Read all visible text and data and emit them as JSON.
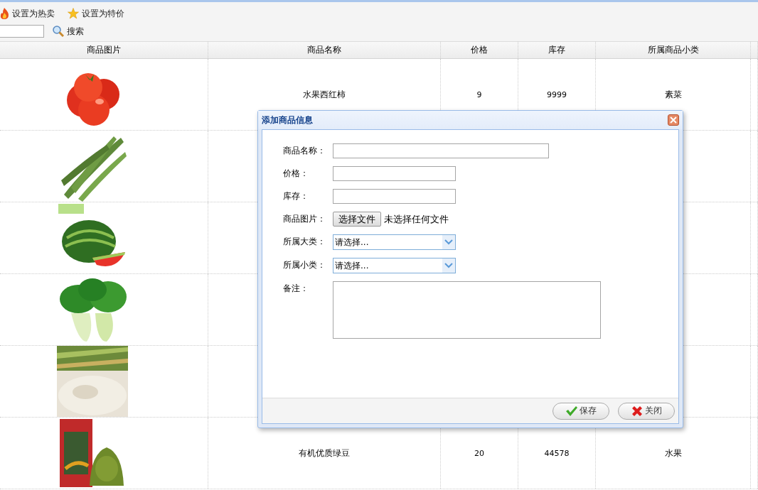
{
  "toolbar": {
    "actions": [
      {
        "label": "设置为热卖",
        "kind": "hot"
      },
      {
        "label": "设置为特价",
        "kind": "special"
      }
    ],
    "search_button": "搜索"
  },
  "table": {
    "columns": [
      "商品图片",
      "商品名称",
      "价格",
      "库存",
      "所属商品小类"
    ],
    "rows": [
      {
        "image": {
          "kind": "picture"
        },
        "name": "水果西红柿",
        "price": "9",
        "stock": "9999",
        "subcategory": "素菜"
      },
      {
        "image": {
          "kind": "picture"
        }
      },
      {
        "image": {
          "kind": "picture"
        }
      },
      {
        "image": {
          "kind": "picture"
        }
      },
      {
        "image": {
          "kind": "picture"
        }
      },
      {
        "image": {
          "kind": "picture"
        },
        "name": "有机优质绿豆",
        "price": "20",
        "stock": "44578",
        "subcategory": "水果"
      }
    ]
  },
  "dialog": {
    "title": "添加商品信息",
    "fields": [
      {
        "label": "商品名称：",
        "kind": "long-text"
      },
      {
        "label": "价格：",
        "kind": "text"
      },
      {
        "label": "库存：",
        "kind": "text"
      },
      {
        "label": "商品图片：",
        "kind": "file",
        "button": "选择文件",
        "status": "未选择任何文件"
      },
      {
        "label": "所属大类：",
        "kind": "select",
        "value": "请选择..."
      },
      {
        "label": "所属小类：",
        "kind": "select",
        "value": "请选择..."
      },
      {
        "label": "备注：",
        "kind": "textarea"
      }
    ],
    "buttons": [
      {
        "label": "保存",
        "kind": "save"
      },
      {
        "label": "关闭",
        "kind": "close"
      }
    ]
  }
}
